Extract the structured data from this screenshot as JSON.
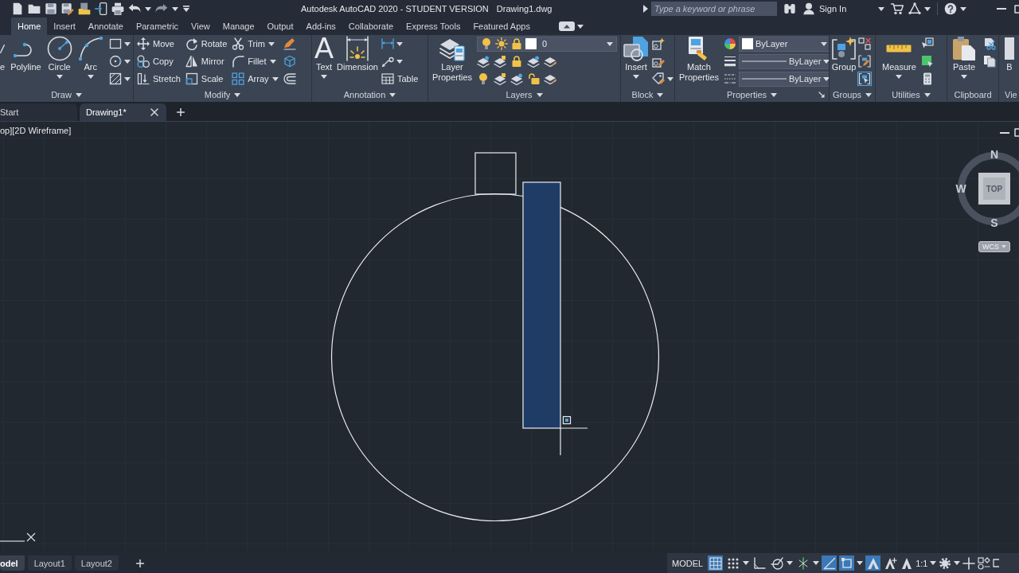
{
  "title_bar": {
    "title": "Autodesk AutoCAD 2020 - STUDENT VERSION",
    "file": "Drawing1.dwg",
    "search": {
      "placeholder": "Type a keyword or phrase"
    },
    "sign_in": "Sign In"
  },
  "ribbon_tabs": [
    {
      "label": "Home",
      "selected": true
    },
    {
      "label": "Insert",
      "selected": false
    },
    {
      "label": "Annotate",
      "selected": false
    },
    {
      "label": "Parametric",
      "selected": false
    },
    {
      "label": "View",
      "selected": false
    },
    {
      "label": "Manage",
      "selected": false
    },
    {
      "label": "Output",
      "selected": false
    },
    {
      "label": "Add-ins",
      "selected": false
    },
    {
      "label": "Collaborate",
      "selected": false
    },
    {
      "label": "Express Tools",
      "selected": false
    },
    {
      "label": "Featured Apps",
      "selected": false
    }
  ],
  "ribbon_panels": [
    {
      "title": "Draw",
      "tools": [
        "e",
        "Polyline",
        "Circle",
        "Arc"
      ]
    },
    {
      "title": "Modify",
      "tools": [
        "Move",
        "Copy",
        "Stretch",
        "Rotate",
        "Mirror",
        "Scale",
        "Trim",
        "Fillet",
        "Array"
      ]
    },
    {
      "title": "Annotation",
      "glyph": "A",
      "tools": [
        "Text",
        "Dimension",
        "Table"
      ]
    },
    {
      "title": "Layers",
      "tools": [
        "Layer Properties"
      ],
      "dropdowns": [
        "0"
      ]
    },
    {
      "title": "Block",
      "tools": [
        "Insert"
      ]
    },
    {
      "title": "Properties",
      "tools": [
        "Match Properties"
      ],
      "dropdowns": [
        "ByLayer",
        "ByLayer",
        "ByLayer"
      ]
    },
    {
      "title": "Groups",
      "tools": [
        "Group"
      ],
      "toggles": [
        {
          "on": true
        }
      ]
    },
    {
      "title": "Utilities",
      "tools": [
        "Measure"
      ]
    },
    {
      "title": "Clipboard",
      "tools": [
        "Paste"
      ]
    },
    {
      "title": "Vie",
      "tools": [
        "B"
      ]
    }
  ],
  "document_tabs": [
    {
      "label": "Start",
      "selected": false,
      "closable": false
    },
    {
      "label": "Drawing1*",
      "selected": true,
      "closable": true
    }
  ],
  "viewport": {
    "label": "op][2D Wireframe]",
    "viewcube": {
      "directions": [
        "N",
        "W",
        "S"
      ],
      "face": "TOP",
      "ucs": "WCS"
    }
  },
  "layout_tabs": [
    {
      "label": "odel",
      "selected": true
    },
    {
      "label": "Layout1",
      "selected": false
    },
    {
      "label": "Layout2",
      "selected": false
    }
  ],
  "status_bar": {
    "space": "MODEL",
    "toggles": [
      {
        "on": true
      },
      {
        "on": false
      },
      {
        "on": false
      },
      {
        "on": false
      },
      {
        "on": false
      },
      {
        "on": true
      },
      {
        "on": true
      },
      {
        "on": true
      },
      {
        "on": false
      }
    ],
    "scale": "1:1"
  }
}
